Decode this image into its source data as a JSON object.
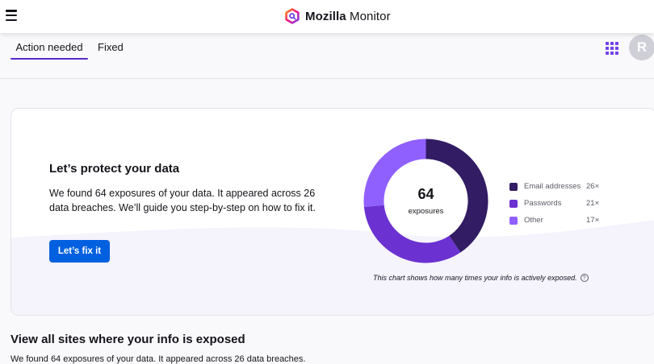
{
  "header": {
    "brand_strong": "Mozilla",
    "brand_rest": " Monitor",
    "menu_icon": "hamburger-icon",
    "logo_icon": "monitor-logo-icon"
  },
  "tabs": [
    {
      "label": "Action needed",
      "active": true
    },
    {
      "label": "Fixed",
      "active": false
    }
  ],
  "apps_icon": "apps-grid-icon",
  "avatar": {
    "initial": "R"
  },
  "card": {
    "title": "Let’s protect your data",
    "description": "We found 64 exposures of your data. It appeared across 26 data breaches. We’ll guide you step-by-step on how to fix it.",
    "button_label": "Let’s fix it",
    "donut_total": "64",
    "donut_label": "exposures",
    "chart_note": "This chart shows how many times your info is actively exposed.",
    "help_icon": "question-circle-icon"
  },
  "chart_data": {
    "type": "pie",
    "center_value": "64",
    "center_label": "exposures",
    "categories": [
      "Email addresses",
      "Passwords",
      "Other"
    ],
    "values": [
      26,
      21,
      17
    ],
    "value_labels": [
      "26×",
      "21×",
      "17×"
    ],
    "colors": [
      "#321c64",
      "#6b31d1",
      "#9060ff"
    ],
    "legend_position": "right"
  },
  "section": {
    "title": "View all sites where your info is exposed",
    "description": "We found 64 exposures of your data. It appeared across 26 data breaches."
  }
}
